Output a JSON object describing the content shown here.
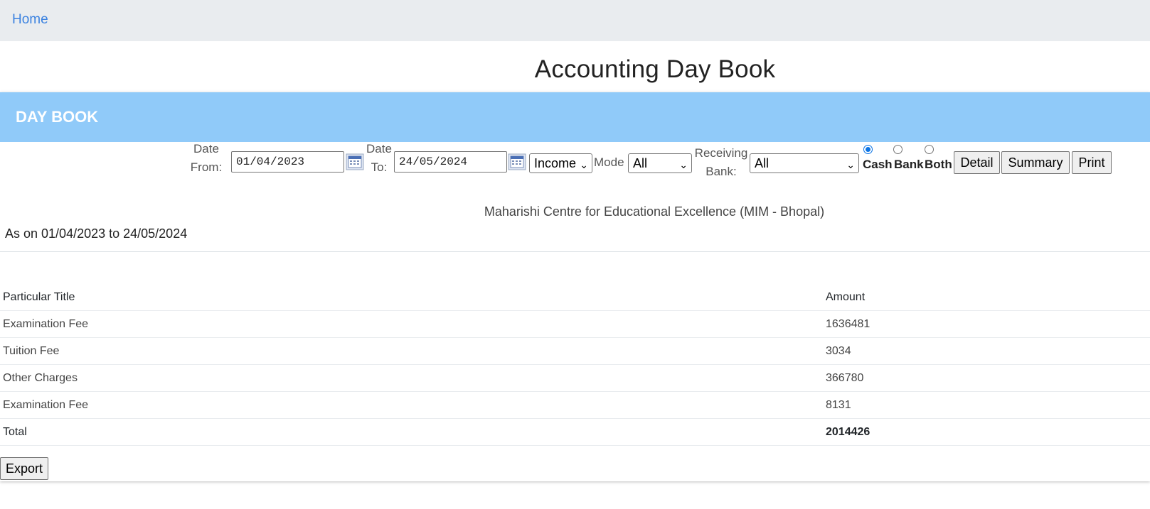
{
  "nav": {
    "home": "Home"
  },
  "page_title": "Accounting Day Book",
  "panel_title": "DAY BOOK",
  "filters": {
    "date_from_label_1": "Date",
    "date_from_label_2": "From:",
    "date_from_value": "01/04/2023",
    "date_to_label_1": "Date",
    "date_to_label_2": "To:",
    "date_to_value": "24/05/2024",
    "type_selected": "Income",
    "mode_label": "Mode",
    "mode_selected": "All",
    "bank_label_1": "Receiving",
    "bank_label_2": "Bank:",
    "bank_selected": "All",
    "radio_cash": "Cash",
    "radio_bank": "Bank",
    "radio_both": "Both",
    "radio_selected": "Cash",
    "btn_detail": "Detail",
    "btn_summary": "Summary",
    "btn_print": "Print"
  },
  "institute": "Maharishi Centre for Educational Excellence (MIM - Bhopal)",
  "period": "As on 01/04/2023 to 24/05/2024",
  "table": {
    "headers": [
      "Particular Title",
      "Amount"
    ],
    "rows": [
      [
        "Examination Fee",
        "1636481"
      ],
      [
        "Tuition Fee",
        "3034"
      ],
      [
        "Other Charges",
        "366780"
      ],
      [
        "Examination Fee",
        "8131"
      ]
    ],
    "total_label": "Total",
    "total_value": "2014426"
  },
  "export_label": "Export",
  "icons": {
    "calendar": "calendar-icon",
    "dropdown": "chevron-down-icon"
  },
  "colors": {
    "header_bg": "#90caf9",
    "navbar_bg": "#e9ecef",
    "link": "#3b82e0"
  }
}
